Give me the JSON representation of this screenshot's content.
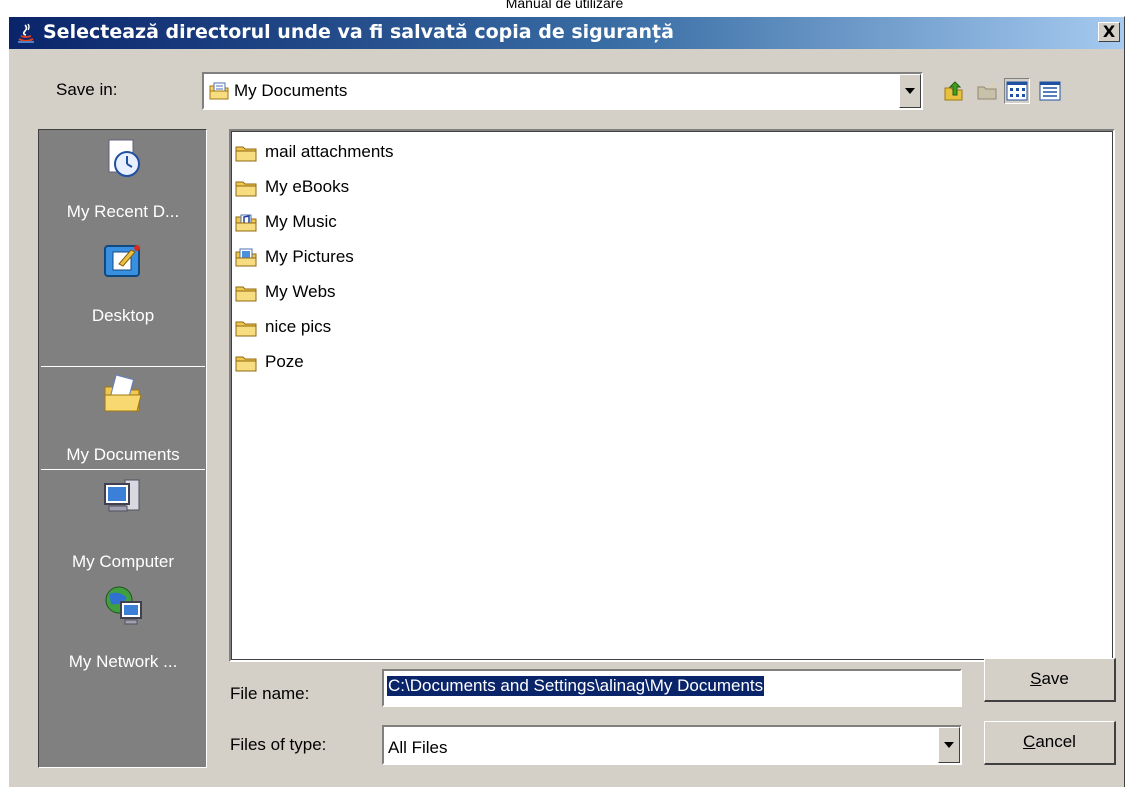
{
  "page_header": "Manual de utilizare",
  "dialog": {
    "title": "Selectează directorul unde va fi salvată copia de siguranță",
    "close_label": "X"
  },
  "save_in": {
    "label": "Save in:",
    "value": "My Documents"
  },
  "toolbar": {
    "icons": [
      "up-one-level-icon",
      "new-folder-icon",
      "list-view-icon",
      "details-view-icon"
    ]
  },
  "places": [
    {
      "label": "My Recent D...",
      "icon": "recent-documents-icon"
    },
    {
      "label": "Desktop",
      "icon": "desktop-icon"
    },
    {
      "label": "My Documents",
      "icon": "my-documents-icon",
      "selected": true
    },
    {
      "label": "My Computer",
      "icon": "computer-icon"
    },
    {
      "label": "My Network ...",
      "icon": "network-icon"
    }
  ],
  "files": [
    {
      "name": "mail attachments",
      "icon": "folder-icon"
    },
    {
      "name": "My eBooks",
      "icon": "folder-icon"
    },
    {
      "name": "My Music",
      "icon": "music-folder-icon"
    },
    {
      "name": "My Pictures",
      "icon": "pictures-folder-icon"
    },
    {
      "name": "My Webs",
      "icon": "folder-icon"
    },
    {
      "name": "nice pics",
      "icon": "folder-icon"
    },
    {
      "name": "Poze",
      "icon": "folder-icon"
    }
  ],
  "file_name": {
    "label": "File name:",
    "value": "C:\\Documents and Settings\\alinag\\My Documents"
  },
  "file_type": {
    "label": "Files of type:",
    "value": "All Files"
  },
  "buttons": {
    "save_mnemonic": "S",
    "save_rest": "ave",
    "cancel_mnemonic": "C",
    "cancel_rest": "ancel"
  },
  "colors": {
    "title_gradient_start": "#0a246a",
    "title_gradient_end": "#a6caf0",
    "dialog_bg": "#d4d0c8",
    "places_bg": "#808080",
    "selection": "#0a246a"
  }
}
